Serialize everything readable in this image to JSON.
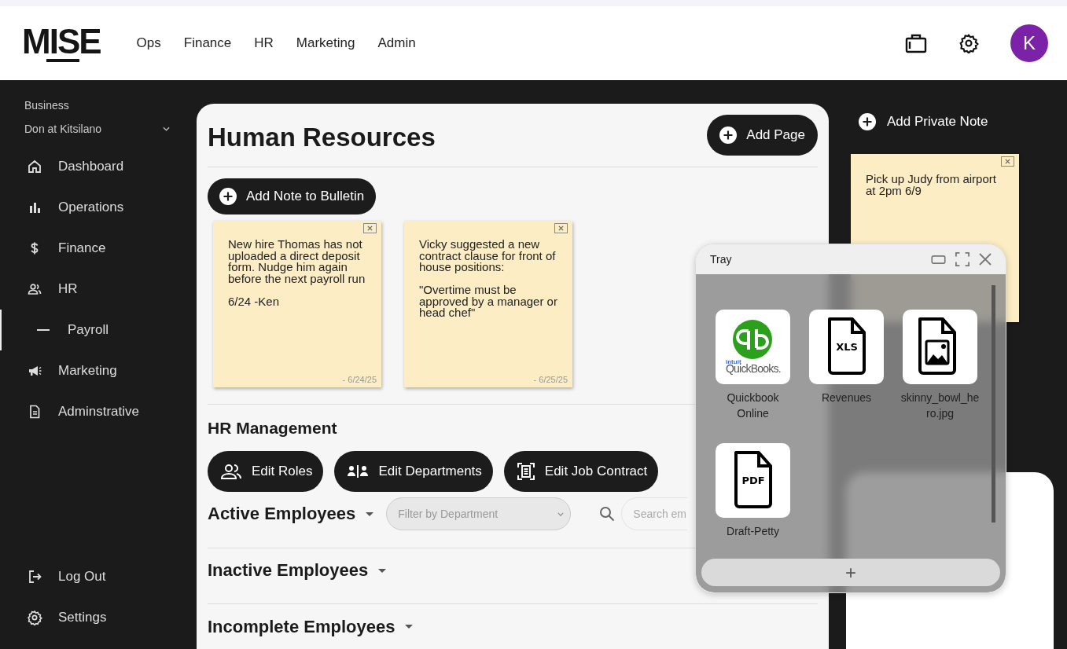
{
  "header": {
    "logo": "MISE",
    "nav": [
      "Ops",
      "Finance",
      "HR",
      "Marketing",
      "Admin"
    ],
    "avatar": "K"
  },
  "sidebar": {
    "label": "Business",
    "business": "Don at Kitsilano",
    "items": [
      {
        "label": "Dashboard",
        "selected": false
      },
      {
        "label": "Operations",
        "selected": false
      },
      {
        "label": "Finance",
        "selected": false
      },
      {
        "label": "HR",
        "selected": false,
        "children": [
          {
            "label": "Payroll",
            "selected": true
          }
        ]
      },
      {
        "label": "Marketing",
        "selected": false
      },
      {
        "label": "Adminstrative",
        "selected": false
      }
    ],
    "bottom": [
      "Log Out",
      "Settings"
    ]
  },
  "main": {
    "title": "Human Resources",
    "add_page": "Add Page",
    "add_note": "Add Note to Bulletin",
    "notes": [
      {
        "text": "New hire Thomas has not uploaded a direct deposit form. Nudge him again before the next payroll run\n\n6/24 -Ken",
        "date": "- 6/24/25"
      },
      {
        "text": "Vicky suggested a new contract clause for front of house positions:\n\n\"Overtime must be approved by a manager or head chef\"",
        "date": "- 6/25/25"
      }
    ],
    "management_title": "HR Management",
    "management_buttons": [
      "Edit Roles",
      "Edit Departments",
      "Edit Job Contract"
    ],
    "sections": [
      {
        "title": "Active Employees",
        "filter_placeholder": "Filter by Department",
        "search_placeholder": "Search em"
      },
      {
        "title": "Inactive Employees"
      },
      {
        "title": "Incomplete Employees"
      }
    ]
  },
  "private": {
    "add": "Add Private Note",
    "notes": [
      {
        "text": "Pick up Judy from airport at 2pm 6/9"
      }
    ]
  },
  "tray": {
    "title": "Tray",
    "items": [
      {
        "kind": "quickbooks",
        "logo": [
          "intuit",
          "QuickBooks."
        ],
        "label": "Quickbook Online"
      },
      {
        "kind": "file",
        "badge": "XLS",
        "label": "Revenues"
      },
      {
        "kind": "image",
        "label": "skinny_bowl_hero.jpg"
      },
      {
        "kind": "file",
        "badge": "PDF",
        "label": "Draft-Petty"
      }
    ],
    "add": "+"
  }
}
